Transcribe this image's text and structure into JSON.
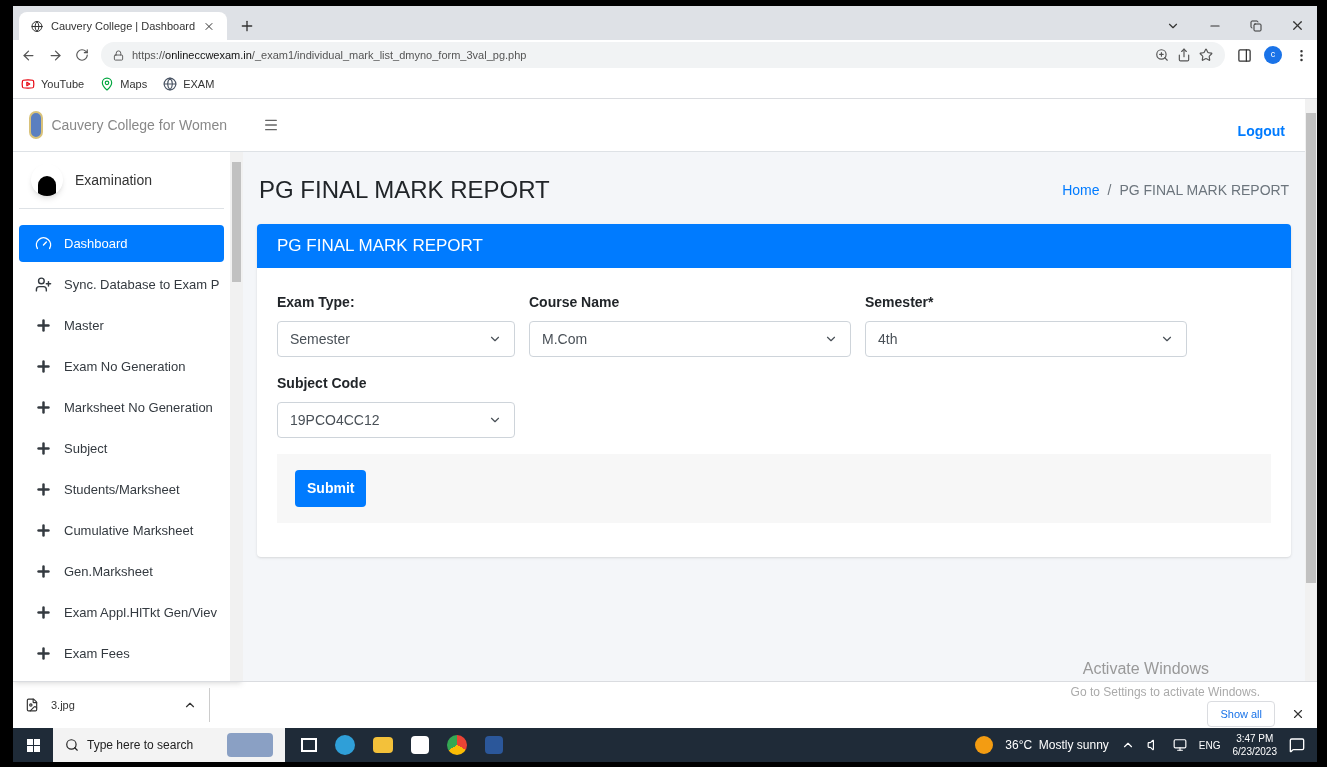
{
  "browser": {
    "tab_title": "Cauvery College | Dashboard",
    "url_prefix": "https://",
    "url_host": "onlineccwexam.in",
    "url_path": "/_exam1/individual_mark_list_dmyno_form_3val_pg.php",
    "avatar_letter": "c",
    "bookmarks": [
      {
        "kind": "youtube",
        "label": "YouTube"
      },
      {
        "kind": "maps",
        "label": "Maps"
      },
      {
        "kind": "globe",
        "label": "EXAM"
      }
    ]
  },
  "sidebar": {
    "brand": "Cauvery College for Women",
    "user": "Examination",
    "items": [
      {
        "kind": "dashboard",
        "label": "Dashboard",
        "selected": true
      },
      {
        "kind": "user-plus",
        "label": "Sync. Database to Exam P",
        "selected": false
      },
      {
        "kind": "plus",
        "label": "Master",
        "selected": false
      },
      {
        "kind": "plus",
        "label": "Exam No Generation",
        "selected": false
      },
      {
        "kind": "plus",
        "label": "Marksheet No Generation",
        "selected": false
      },
      {
        "kind": "plus",
        "label": "Subject",
        "selected": false
      },
      {
        "kind": "plus",
        "label": "Students/Marksheet",
        "selected": false
      },
      {
        "kind": "plus",
        "label": "Cumulative Marksheet",
        "selected": false
      },
      {
        "kind": "plus",
        "label": "Gen.Marksheet",
        "selected": false
      },
      {
        "kind": "plus",
        "label": "Exam Appl.HlTkt Gen/Viev",
        "selected": false
      },
      {
        "kind": "plus",
        "label": "Exam Fees",
        "selected": false
      }
    ]
  },
  "topbar": {
    "logout": "Logout"
  },
  "page": {
    "title": "PG FINAL MARK REPORT",
    "breadcrumb": [
      "Home",
      "PG FINAL MARK REPORT"
    ],
    "breadcrumb_separator": "/"
  },
  "card": {
    "header": "PG FINAL MARK REPORT",
    "fields": [
      {
        "label": "Exam Type:",
        "value": "Semester"
      },
      {
        "label": "Course Name",
        "value": "M.Com"
      },
      {
        "label": "Semester*",
        "value": "4th"
      },
      {
        "label": "Subject Code",
        "value": "19PCO4CC12"
      }
    ],
    "submit": "Submit"
  },
  "activation": {
    "title": "Activate Windows",
    "subtitle": "Go to Settings to activate Windows."
  },
  "downloads": {
    "file": "3.jpg",
    "show_all": "Show all"
  },
  "taskbar": {
    "search_placeholder": "Type here to search",
    "weather": "36°C  Mostly sunny",
    "language": "ENG",
    "time": "3:47 PM",
    "date": "6/23/2023"
  }
}
